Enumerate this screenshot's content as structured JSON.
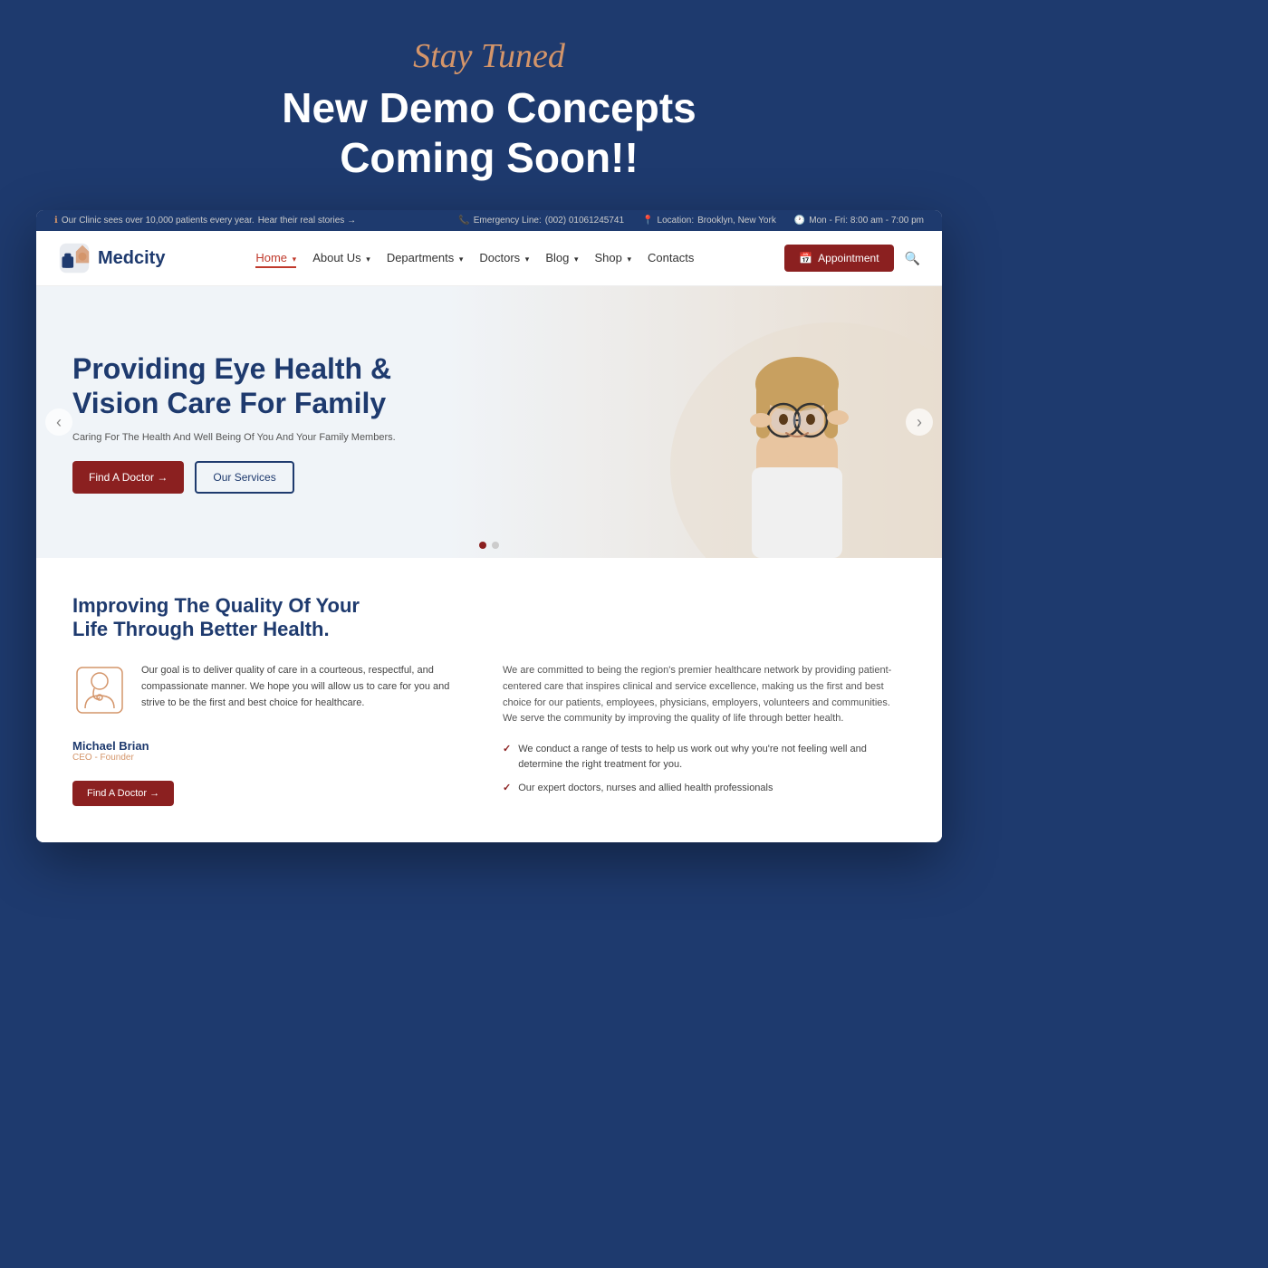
{
  "announcement": {
    "stay_tuned": "Stay Tuned",
    "heading_line1": "New Demo Concepts",
    "heading_line2": "Coming Soon!!"
  },
  "topbar": {
    "clinic_text": "Our Clinic sees over 10,000 patients every year.",
    "hear_text": "Hear their real stories →",
    "emergency_label": "Emergency Line:",
    "emergency_number": "(002) 01061245741",
    "location_label": "Location:",
    "location_value": "Brooklyn, New York",
    "hours": "Mon - Fri: 8:00 am - 7:00 pm"
  },
  "navbar": {
    "logo_text": "Medcity",
    "nav_items": [
      {
        "label": "Home",
        "active": true
      },
      {
        "label": "About Us",
        "active": false,
        "has_dropdown": true
      },
      {
        "label": "Departments",
        "active": false,
        "has_dropdown": true
      },
      {
        "label": "Doctors",
        "active": false,
        "has_dropdown": true
      },
      {
        "label": "Blog",
        "active": false,
        "has_dropdown": true
      },
      {
        "label": "Shop",
        "active": false,
        "has_dropdown": true
      },
      {
        "label": "Contacts",
        "active": false
      }
    ],
    "appointment_label": "Appointment"
  },
  "hero": {
    "heading": "Providing Eye Health & Vision Care For Family",
    "tagline": "Caring For The Health And Well Being Of You And Your Family Members.",
    "btn_primary": "Find A Doctor →",
    "btn_secondary": "Our Services",
    "carousel_dot1_active": true,
    "carousel_dot2_active": false
  },
  "about": {
    "heading_line1": "Improving The Quality Of Your",
    "heading_line2": "Life Through Better Health.",
    "left_description": "Our goal is to deliver quality of care in a courteous, respectful, and compassionate manner. We hope you will allow us to care for you and strive to be the first and best choice for healthcare.",
    "ceo_name": "Michael Brian",
    "ceo_title": "CEO - Founder",
    "find_doctor_btn": "Find A Doctor →",
    "right_description": "We are committed to being the region's premier healthcare network by providing patient-centered care that inspires clinical and service excellence, making us the first and best choice for our patients, employees, physicians, employers, volunteers and communities. We serve the community by improving the quality of life through better health.",
    "check_items": [
      "We conduct a range of tests to help us work out why you're not feeling well and determine the right treatment for you.",
      "Our expert doctors, nurses and allied health professionals"
    ]
  }
}
